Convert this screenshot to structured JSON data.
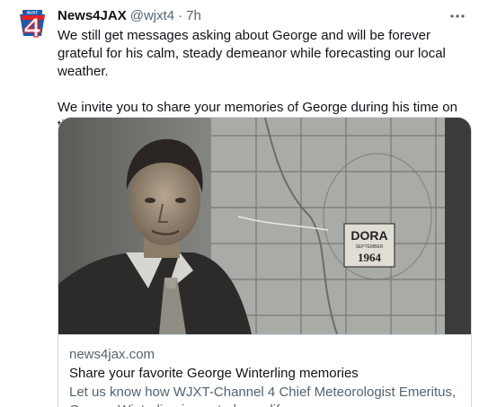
{
  "tweet": {
    "avatar_icon": "news4-logo-icon",
    "author_name": "News4JAX",
    "author_handle": "@wjxt4",
    "separator": "·",
    "time": "7h",
    "more_icon": "more-options-icon",
    "body": "We still get messages asking about George and will be forever grateful for his calm, steady demeanor while forecasting our local weather.\n\nWe invite you to share your memories of George during his time on the air by filling out the form in this story."
  },
  "card": {
    "image_label_1": "DORA",
    "image_label_2": "SEPTEMBER",
    "image_label_3": "1964",
    "domain": "news4jax.com",
    "title": "Share your favorite George Winterling memories",
    "description": "Let us know how WJXT-Channel 4 Chief Meteorologist Emeritus, George Winterling impacted your life"
  },
  "colors": {
    "logo_red": "#e41f26",
    "logo_blue": "#1a5bb0",
    "secondary_text": "#536471",
    "border": "#cfd9de"
  }
}
